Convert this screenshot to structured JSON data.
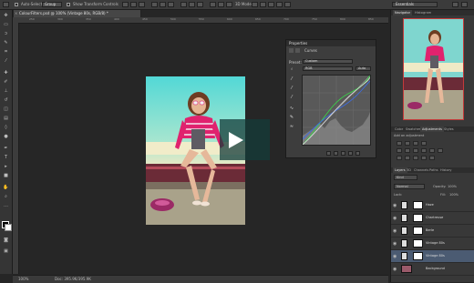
{
  "options_bar": {
    "auto_select_label": "Auto-Select:",
    "auto_select_value": "Group",
    "show_transform_label": "Show Transform Controls",
    "mode_3d_label": "3D Mode:",
    "workspace": "Essentials"
  },
  "document": {
    "tab_title": "ColourFilters.psd @ 100% (Vintage 80s, RGB/8) *",
    "zoom": "100%",
    "doc_size": "Doc: 395.9K/395.9K"
  },
  "ruler": {
    "h_ticks": [
      "250",
      "300",
      "350",
      "400",
      "450",
      "500",
      "550",
      "600",
      "650",
      "700",
      "750",
      "800",
      "850"
    ]
  },
  "properties": {
    "panel_title": "Properties",
    "adjustment_name": "Curves",
    "preset_label": "Preset:",
    "preset_value": "Custom",
    "channel_value": "RGB",
    "auto_label": "Auto"
  },
  "right_panel": {
    "nav_tabs": [
      "Navigator",
      "Histogram"
    ],
    "mid_tabs": [
      "Color",
      "Swatches",
      "Adjustments",
      "Styles"
    ],
    "add_adjustment": "Add an adjustment",
    "layer_tabs": [
      "Layers",
      "3D",
      "Channels",
      "Paths",
      "History"
    ],
    "kind_label": "Kind",
    "blend_mode": "Normal",
    "opacity_label": "Opacity:",
    "opacity_value": "100%",
    "lock_label": "Lock:",
    "fill_label": "Fill:",
    "fill_value": "100%",
    "layers": [
      "Haze",
      "Chartreuse",
      "Berle",
      "Vintage 80s",
      "Vintage 80s",
      "Background"
    ],
    "active_layer_index": 4
  },
  "colors": {
    "accent_selected_layer": "#4b5b72",
    "navigator_frame": "#c43a3a"
  }
}
